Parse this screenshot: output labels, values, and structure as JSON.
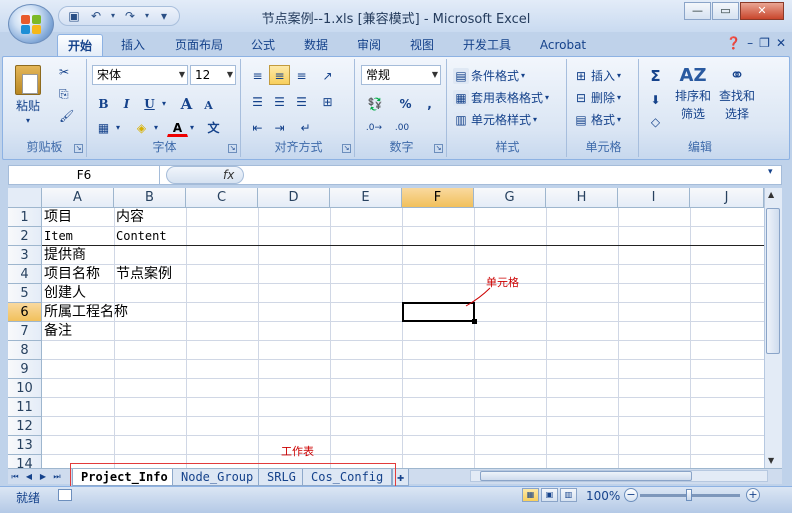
{
  "window": {
    "title": "节点案例--1.xls  [兼容模式] - Microsoft Excel"
  },
  "qat": {
    "icons": [
      "save-icon",
      "undo-icon",
      "redo-icon",
      "customize-icon"
    ]
  },
  "tabs": [
    "开始",
    "插入",
    "页面布局",
    "公式",
    "数据",
    "审阅",
    "视图",
    "开发工具",
    "Acrobat"
  ],
  "active_tab": "开始",
  "ribbon": {
    "clipboard": {
      "label": "剪贴板",
      "paste": "粘贴"
    },
    "font": {
      "label": "字体",
      "name": "宋体",
      "size": "12",
      "bold": "B",
      "italic": "I",
      "underline": "U",
      "grow": "A",
      "shrink": "A",
      "wen": "文"
    },
    "alignment": {
      "label": "对齐方式"
    },
    "number": {
      "label": "数字",
      "format": "常规",
      "percent": "%",
      "comma": ","
    },
    "styles": {
      "label": "样式",
      "conditional": "条件格式",
      "table": "套用表格格式",
      "cell": "单元格样式"
    },
    "cells": {
      "label": "单元格",
      "insert": "插入",
      "delete": "删除",
      "format": "格式"
    },
    "editing": {
      "label": "编辑",
      "sort": "排序和",
      "sort2": "筛选",
      "find": "查找和",
      "find2": "选择"
    }
  },
  "formula_bar": {
    "name_box": "F6",
    "fx": "fx",
    "content": ""
  },
  "columns": [
    "A",
    "B",
    "C",
    "D",
    "E",
    "F",
    "G",
    "H",
    "I",
    "J"
  ],
  "selected_column": "F",
  "rows": [
    "1",
    "2",
    "3",
    "4",
    "5",
    "6",
    "7",
    "8",
    "9",
    "10",
    "11",
    "12",
    "13",
    "14"
  ],
  "selected_row": "6",
  "cells": {
    "A1": "项目",
    "B1": "内容",
    "A2": "Item",
    "B2": "Content",
    "A3": "提供商",
    "A4": "项目名称",
    "B4": "节点案例",
    "A5": "创建人",
    "A6": "所属工程名称",
    "A7": "备注"
  },
  "annotations": {
    "cell": "单元格",
    "sheet": "工作表"
  },
  "sheets": [
    "Project_Info",
    "Node_Group",
    "SRLG",
    "Cos_Config"
  ],
  "active_sheet": "Project_Info",
  "status": {
    "ready": "就绪",
    "zoom": "100%"
  }
}
